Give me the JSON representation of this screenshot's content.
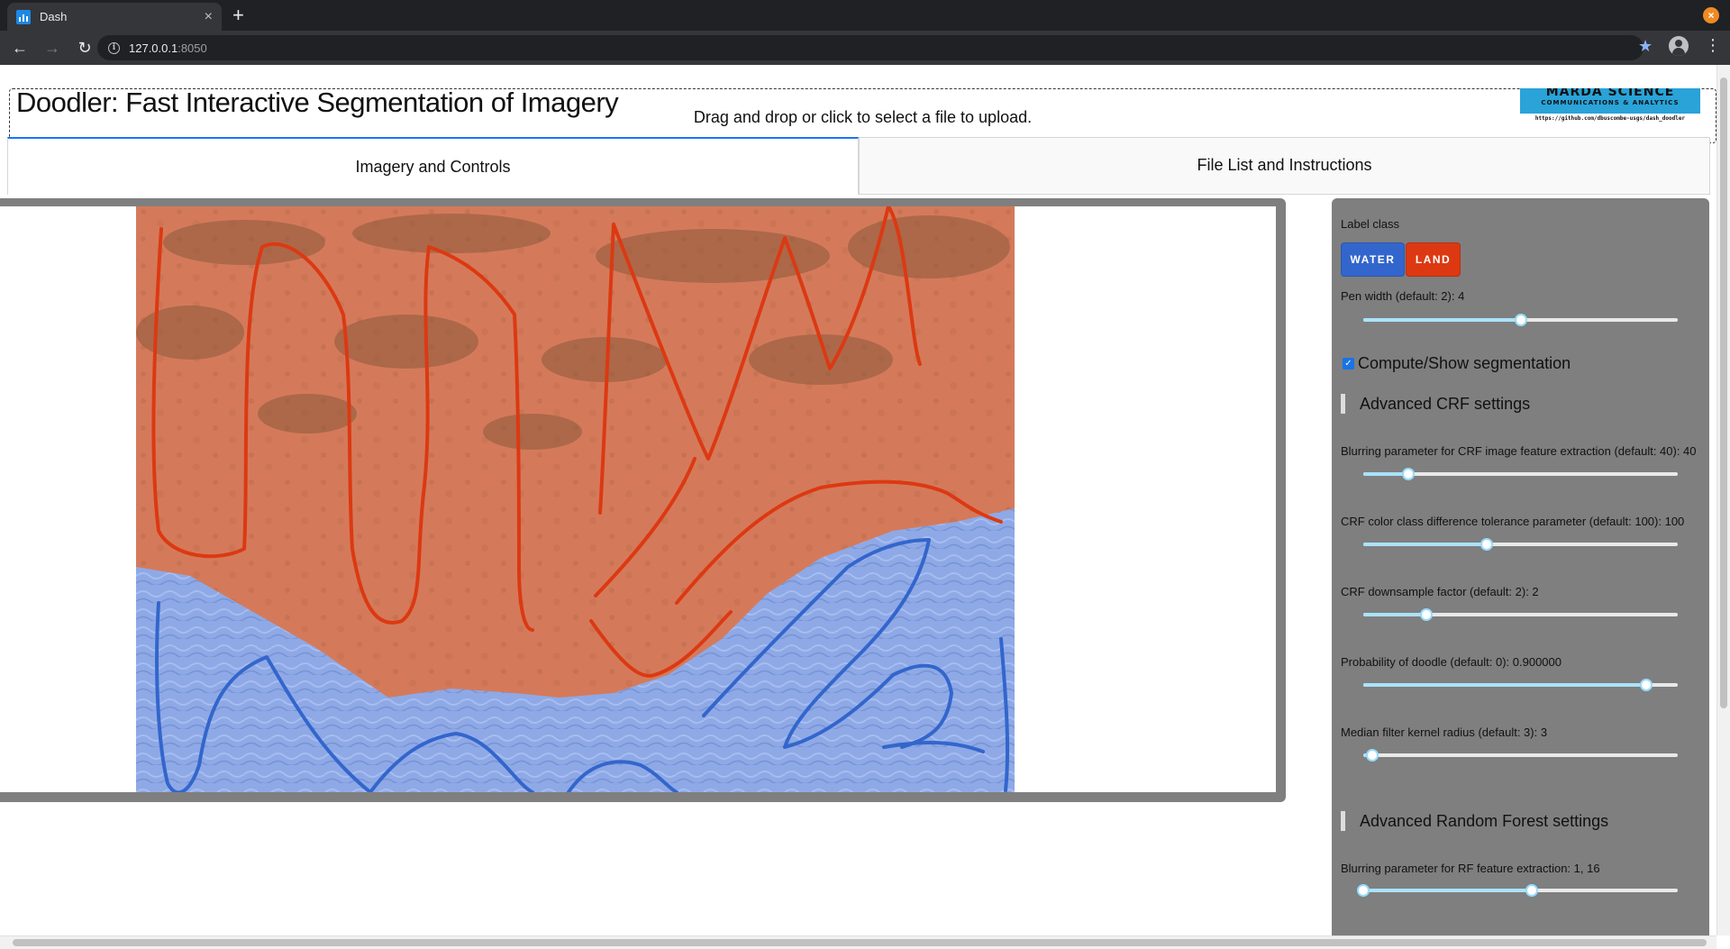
{
  "browser": {
    "tab_title": "Dash",
    "tab_close": "×",
    "new_tab": "+",
    "window_close": "×",
    "back": "←",
    "forward": "→",
    "reload": "↻",
    "info": "i",
    "url_host": "127.0.0.1",
    "url_port": ":8050",
    "bookmark": "★",
    "menu": "⋮"
  },
  "header": {
    "title": "Doodler: Fast Interactive Segmentation of Imagery",
    "upload_text": "Drag and drop or click to select a file to upload.",
    "logo_line1": "MARDA SCIENCE",
    "logo_line2": "COMMUNICATIONS & ANALYTICS",
    "logo_url": "https://github.com/dbuscombe-usgs/dash_doodler"
  },
  "tabs": [
    {
      "label": "Imagery and Controls",
      "active": true
    },
    {
      "label": "File List and Instructions",
      "active": false
    }
  ],
  "colors": {
    "water_class": "#3366cc",
    "land_class": "#dc3912",
    "tab_active_border": "#1975fa",
    "panel_bg": "#7f7f7f"
  },
  "controls": {
    "label_class_title": "Label class",
    "classes": [
      {
        "label": "WATER",
        "color": "#3366cc"
      },
      {
        "label": "LAND",
        "color": "#dc3912"
      }
    ],
    "pen_width": {
      "label": "Pen width (default: 2): 4",
      "value": 4,
      "min": 1,
      "max": 7
    },
    "compute_checkbox": {
      "label": "Compute/Show segmentation",
      "checked": true
    },
    "crf_section_title": "Advanced CRF settings",
    "crf_sliders": [
      {
        "label": "Blurring parameter for CRF image feature extraction (default: 40): 40",
        "value": 40,
        "min": 10,
        "max": 220
      },
      {
        "label": "CRF color class difference tolerance parameter (default: 100): 100",
        "value": 100,
        "min": 10,
        "max": 240
      },
      {
        "label": "CRF downsample factor (default: 2): 2",
        "value": 2,
        "min": 1,
        "max": 6
      },
      {
        "label": "Probability of doodle (default: 0): 0.900000",
        "value": 0.9,
        "min": 0,
        "max": 1
      },
      {
        "label": "Median filter kernel radius (default: 3): 3",
        "value": 3,
        "min": 0,
        "max": 100
      }
    ],
    "rf_section_title": "Advanced Random Forest settings",
    "rf_sliders": [
      {
        "label": "Blurring parameter for RF feature extraction: 1, 16",
        "range": [
          1,
          16
        ],
        "min": 1,
        "max": 29
      }
    ]
  }
}
